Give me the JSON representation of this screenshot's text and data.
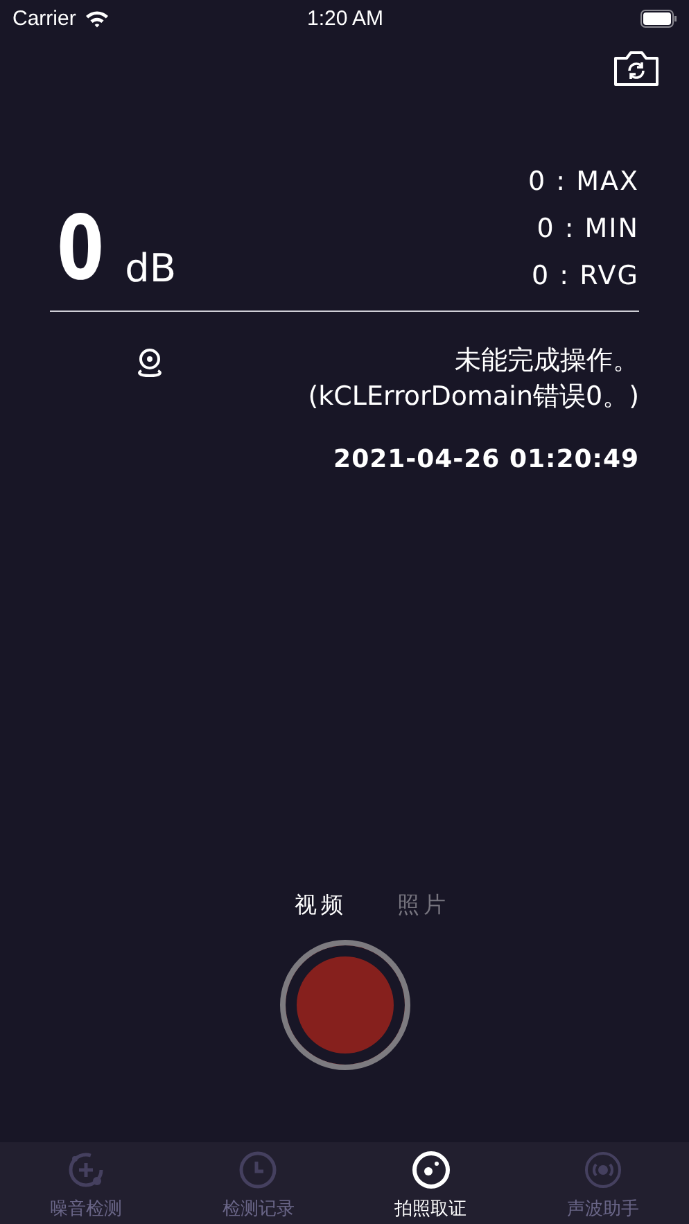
{
  "status_bar": {
    "carrier": "Carrier",
    "time": "1:20 AM"
  },
  "reading": {
    "value": "0",
    "unit": "dB"
  },
  "stats": [
    {
      "text": "0 : MAX"
    },
    {
      "text": "0 : MIN"
    },
    {
      "text": "0 : RVG"
    }
  ],
  "location": {
    "message_lines": [
      "未能完成操作。",
      "(kCLErrorDomain错误0。)"
    ]
  },
  "timestamp": "2021-04-26 01:20:49",
  "modes": [
    {
      "label": "视频",
      "selected": true
    },
    {
      "label": "照片",
      "selected": false
    }
  ],
  "tabs": [
    {
      "label": "噪音检测",
      "selected": false
    },
    {
      "label": "检测记录",
      "selected": false
    },
    {
      "label": "拍照取证",
      "selected": true
    },
    {
      "label": "声波助手",
      "selected": false
    }
  ]
}
